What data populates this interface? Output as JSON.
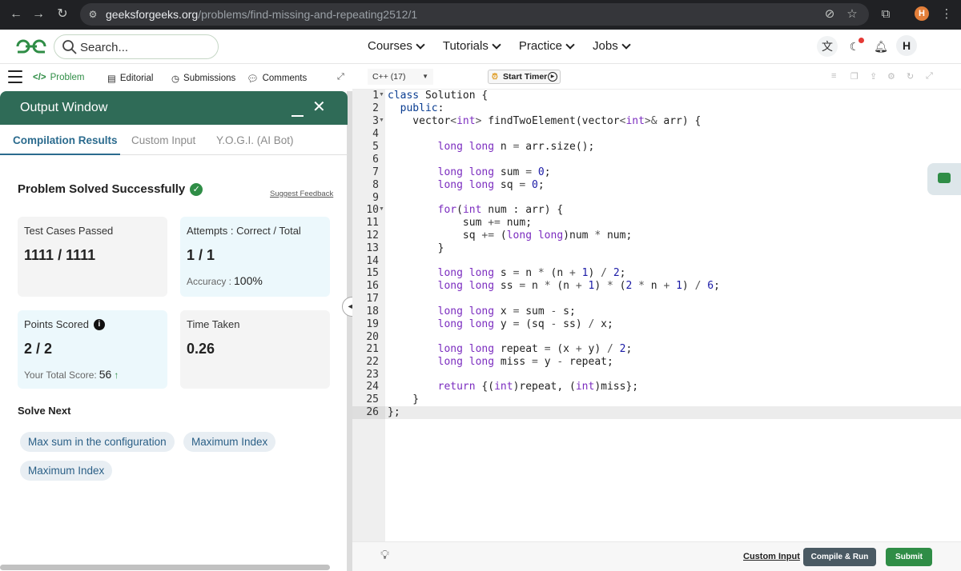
{
  "browser": {
    "url_host": "geeksforgeeks.org",
    "url_path": "/problems/find-missing-and-repeating2512/1",
    "profile_initial": "H"
  },
  "header": {
    "search_placeholder": "Search...",
    "nav": [
      "Courses",
      "Tutorials",
      "Practice",
      "Jobs"
    ],
    "avatar_initial": "H"
  },
  "left_toolbar": {
    "tabs": [
      "Problem",
      "Editorial",
      "Submissions",
      "Comments"
    ]
  },
  "output_window": {
    "title": "Output Window",
    "tabs": [
      "Compilation Results",
      "Custom Input",
      "Y.O.G.I. (AI Bot)"
    ],
    "status": "Problem Solved Successfully",
    "suggest_feedback": "Suggest Feedback",
    "cards": {
      "test_cases_label": "Test Cases Passed",
      "test_cases_value": "1111 / 1111",
      "attempts_label": "Attempts : Correct / Total",
      "attempts_value": "1 / 1",
      "accuracy_label": "Accuracy :",
      "accuracy_value": "100%",
      "points_label": "Points Scored",
      "points_value": "2 / 2",
      "total_score_label": "Your Total Score:",
      "total_score_value": "56",
      "time_label": "Time Taken",
      "time_value": "0.26"
    },
    "solve_next_label": "Solve Next",
    "solve_next": [
      "Max sum in the configuration",
      "Maximum Index",
      "Maximum Index"
    ]
  },
  "editor": {
    "language": "C++ (17)",
    "timer_label": "Start Timer",
    "line_numbers": [
      "1",
      "2",
      "3",
      "4",
      "5",
      "6",
      "7",
      "8",
      "9",
      "10",
      "11",
      "12",
      "13",
      "14",
      "15",
      "16",
      "17",
      "18",
      "19",
      "20",
      "21",
      "22",
      "23",
      "24",
      "25",
      "26"
    ]
  },
  "bottom_bar": {
    "custom_input": "Custom Input",
    "compile_run": "Compile & Run",
    "submit": "Submit"
  }
}
